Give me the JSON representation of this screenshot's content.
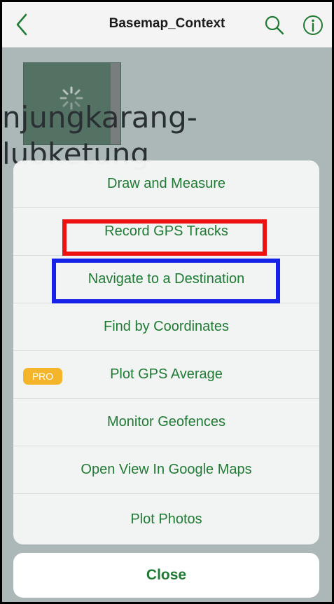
{
  "header": {
    "title": "Basemap_Context",
    "back_icon": "chevron-left-icon",
    "search_icon": "search-icon",
    "info_icon": "info-icon"
  },
  "map": {
    "labels": [
      "njungkarang-",
      "lubketung"
    ]
  },
  "menu": {
    "items": [
      {
        "label": "Draw and Measure"
      },
      {
        "label": "Record GPS Tracks"
      },
      {
        "label": "Navigate to a Destination"
      },
      {
        "label": "Find by Coordinates"
      },
      {
        "label": "Plot GPS Average",
        "badge": "PRO"
      },
      {
        "label": "Monitor Geofences"
      },
      {
        "label": "Open View In Google Maps"
      },
      {
        "label": "Plot Photos"
      }
    ],
    "close_label": "Close"
  },
  "colors": {
    "accent": "#1f7a33",
    "badge": "#f5b52a",
    "highlight_red": "#ee1111",
    "highlight_blue": "#1522e8"
  }
}
